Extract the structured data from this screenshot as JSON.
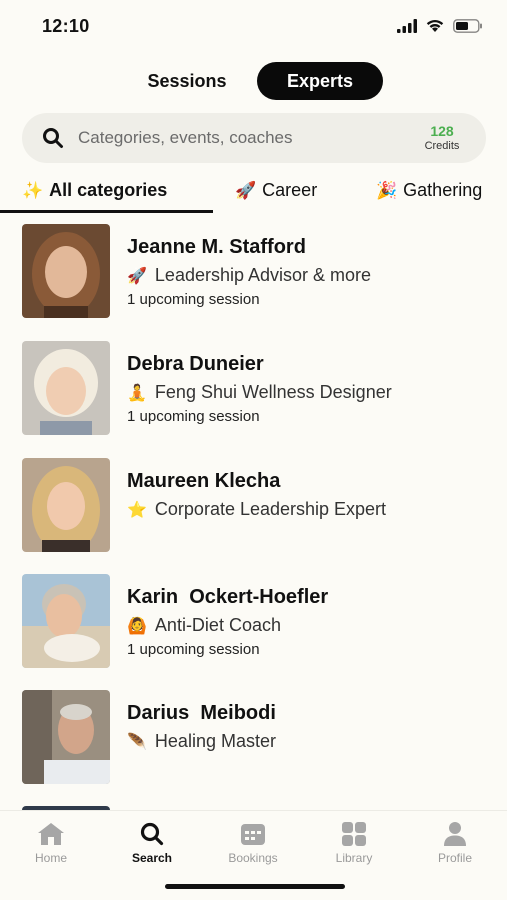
{
  "status": {
    "time": "12:10"
  },
  "segments": {
    "sessions": "Sessions",
    "experts": "Experts",
    "active": "experts"
  },
  "search": {
    "placeholder": "Categories, events, coaches",
    "credits_value": "128",
    "credits_label": "Credits"
  },
  "categories": [
    {
      "emoji": "✨",
      "label": "All categories",
      "active": true
    },
    {
      "emoji": "🚀",
      "label": "Career",
      "active": false
    },
    {
      "emoji": "🎉",
      "label": "Gathering",
      "active": false
    }
  ],
  "experts": [
    {
      "name": "Jeanne M. Stafford",
      "emoji": "🚀",
      "title": "Leadership Advisor & more",
      "sessions": "1 upcoming session"
    },
    {
      "name": "Debra Duneier",
      "emoji": "🧘",
      "title": "Feng Shui Wellness Designer",
      "sessions": "1 upcoming session"
    },
    {
      "name": "Maureen Klecha",
      "emoji": "⭐",
      "title": "Corporate Leadership Expert",
      "sessions": ""
    },
    {
      "name": "Karin  Ockert-Hoefler",
      "emoji": "🙆",
      "title": "Anti-Diet Coach",
      "sessions": "1 upcoming session"
    },
    {
      "name": "Darius  Meibodi",
      "emoji": "🪶",
      "title": "Healing Master",
      "sessions": ""
    }
  ],
  "nav": {
    "home": "Home",
    "search": "Search",
    "bookings": "Bookings",
    "library": "Library",
    "profile": "Profile",
    "active": "search"
  },
  "colors": {
    "accent_dark": "#0a0a0a",
    "credits_green": "#4caf50",
    "background": "#fcfbf6",
    "search_bg": "#efeee8"
  }
}
